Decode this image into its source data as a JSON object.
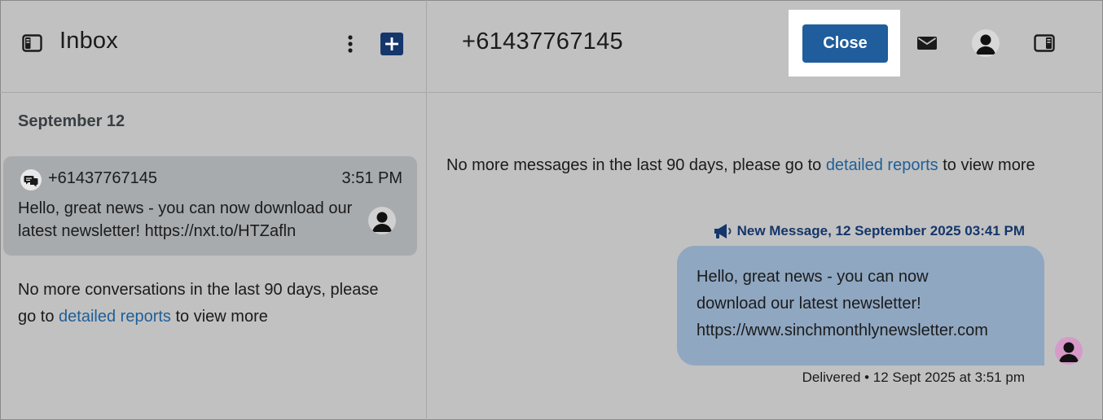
{
  "inbox": {
    "title": "Inbox",
    "add_button_symbol": "+",
    "date_group": "September 12",
    "conversation": {
      "phone": "+61437767145",
      "time": "3:51 PM",
      "preview": "Hello, great news - you can now download our latest newsletter!  https://nxt.to/HTZafln"
    },
    "footer": {
      "before_link": "No more conversations in the last 90 days, please go to ",
      "link": "detailed reports",
      "after_link": " to view more"
    }
  },
  "chat": {
    "contact": "+61437767145",
    "close_label": "Close",
    "history_notice": {
      "before_link": "No more messages in the last 90 days, please go to ",
      "link": "detailed reports",
      "after_link": " to view more"
    },
    "message": {
      "meta": "New Message, 12 September 2025 03:41 PM",
      "lines": [
        "Hello, great news - you can now",
        "download our latest newsletter!",
        "https://www.sinchmonthlynewsletter.com"
      ],
      "status": "Delivered • 12 Sept 2025 at 3:51 pm"
    }
  },
  "colors": {
    "background": "#c1c1c1",
    "accent_dark": "#14366b",
    "button": "#1f5d9c",
    "link": "#1f5f98",
    "bubble": "#8fa7c1"
  },
  "icons": {
    "sidebar_toggle": "sidebar-toggle-icon",
    "more": "more-vertical-icon",
    "add": "plus-icon",
    "channel": "chat-bubbles-icon",
    "mail": "mail-icon",
    "user": "user-icon",
    "panel": "panel-right-icon",
    "megaphone": "megaphone-icon"
  }
}
